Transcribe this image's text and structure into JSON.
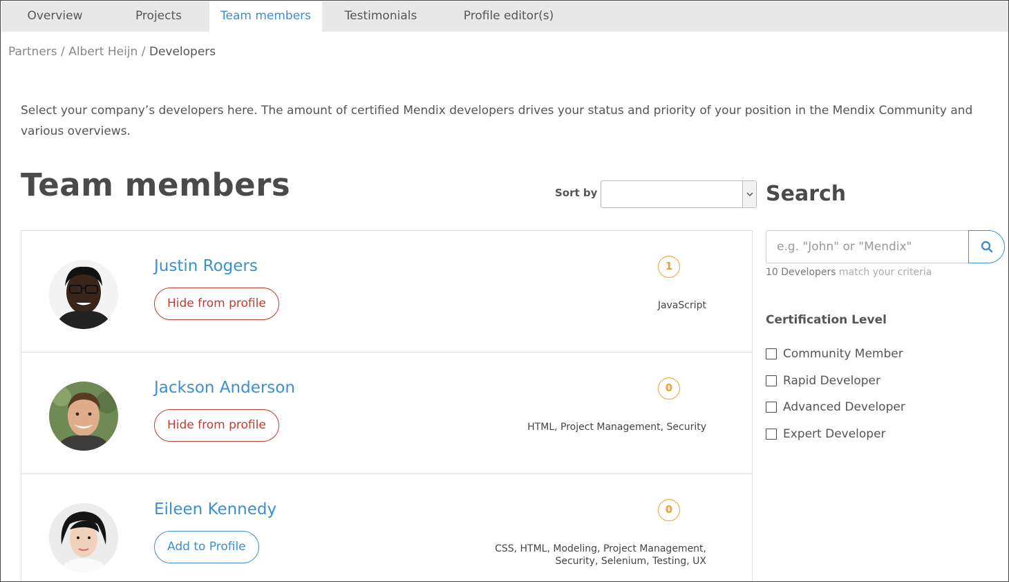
{
  "tabs": [
    {
      "label": "Overview",
      "active": false
    },
    {
      "label": "Projects",
      "active": false
    },
    {
      "label": "Team members",
      "active": true
    },
    {
      "label": "Testimonials",
      "active": false
    },
    {
      "label": "Profile editor(s)",
      "active": false
    }
  ],
  "breadcrumb": {
    "items": [
      "Partners",
      "Albert Heijn",
      "Developers"
    ],
    "separator": "/"
  },
  "intro": "Select your company’s developers here. The amount of certified Mendix developers drives your status and priority of your position in the Mendix Community and various overviews.",
  "page_title": "Team members",
  "sort": {
    "label": "Sort by",
    "value": ""
  },
  "members": [
    {
      "name": "Justin Rogers",
      "action": "Hide from profile",
      "action_type": "hide",
      "count": "1",
      "skills": [
        "JavaScript"
      ]
    },
    {
      "name": "Jackson Anderson",
      "action": "Hide from profile",
      "action_type": "hide",
      "count": "0",
      "skills": [
        "HTML, Project Management, Security"
      ]
    },
    {
      "name": "Eileen Kennedy",
      "action": "Add to Profile",
      "action_type": "add",
      "count": "0",
      "skills": [
        "CSS, HTML, Modeling, Project Management,",
        "Security, Selenium, Testing, UX"
      ]
    }
  ],
  "search": {
    "title": "Search",
    "placeholder": "e.g. \"John\" or \"Mendix\"",
    "value": "",
    "match_count": "10 Developers",
    "match_suffix": "match your criteria"
  },
  "certification": {
    "title": "Certification Level",
    "options": [
      {
        "label": "Community Member",
        "checked": false
      },
      {
        "label": "Rapid Developer",
        "checked": false
      },
      {
        "label": "Advanced Developer",
        "checked": false
      },
      {
        "label": "Expert Developer",
        "checked": false
      }
    ]
  },
  "colors": {
    "accent": "#3a8fd6",
    "danger": "#c23b2e",
    "badge": "#f0a030"
  }
}
